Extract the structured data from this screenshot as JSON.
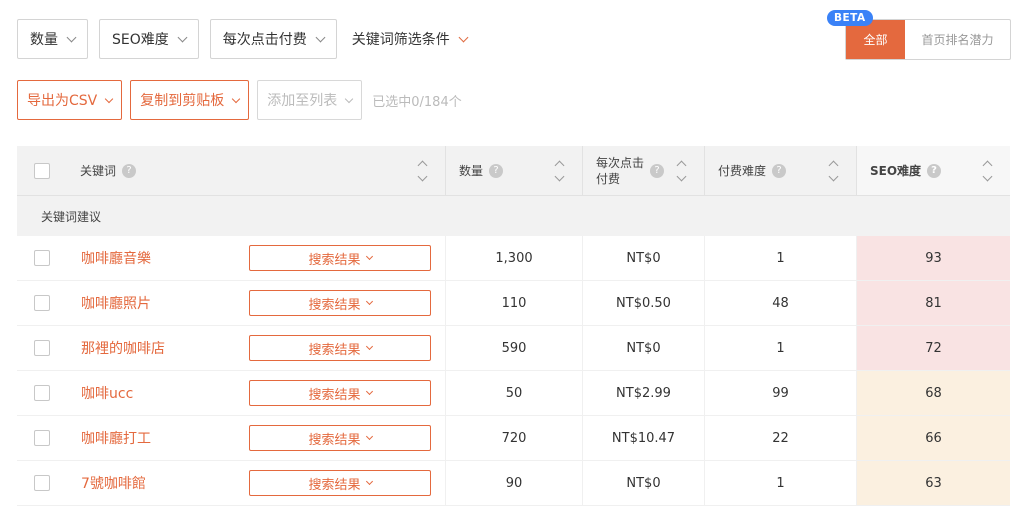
{
  "filters": {
    "volume": "数量",
    "seo_difficulty": "SEO难度",
    "cpc": "每次点击付费",
    "keyword_filter": "关键词筛选条件"
  },
  "toggle": {
    "beta": "BETA",
    "all": "全部",
    "top_potential": "首页排名潜力"
  },
  "actions": {
    "export_csv": "导出为CSV",
    "copy_clipboard": "复制到剪贴板",
    "add_to_list": "添加至列表",
    "selected": "已选中0/184个"
  },
  "colors": {
    "accent": "#e4693e",
    "beta": "#3a82f7",
    "seo_high": "#f9e3e3",
    "seo_mid": "#fbf0e0"
  },
  "table": {
    "headers": {
      "keyword": "关键词",
      "volume": "数量",
      "cpc_line1": "每次点击",
      "cpc_line2": "付费",
      "paid_difficulty": "付费难度",
      "seo_difficulty": "SEO难度"
    },
    "section_label": "关键词建议",
    "serp_label": "搜索结果",
    "rows": [
      {
        "keyword": "咖啡廳音樂",
        "volume": "1,300",
        "cpc": "NT$0",
        "pd": "1",
        "seo": "93"
      },
      {
        "keyword": "咖啡廳照片",
        "volume": "110",
        "cpc": "NT$0.50",
        "pd": "48",
        "seo": "81"
      },
      {
        "keyword": "那裡的咖啡店",
        "volume": "590",
        "cpc": "NT$0",
        "pd": "1",
        "seo": "72"
      },
      {
        "keyword": "咖啡ucc",
        "volume": "50",
        "cpc": "NT$2.99",
        "pd": "99",
        "seo": "68"
      },
      {
        "keyword": "咖啡廳打工",
        "volume": "720",
        "cpc": "NT$10.47",
        "pd": "22",
        "seo": "66"
      },
      {
        "keyword": "7號咖啡館",
        "volume": "90",
        "cpc": "NT$0",
        "pd": "1",
        "seo": "63"
      }
    ]
  }
}
